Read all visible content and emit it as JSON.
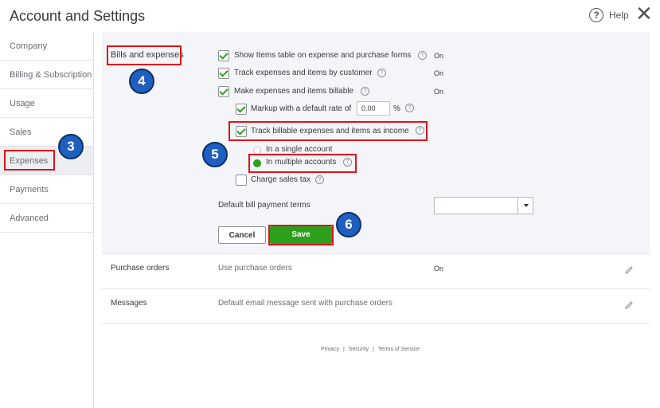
{
  "header": {
    "title": "Account and Settings",
    "help_label": "Help"
  },
  "sidebar": {
    "items": [
      {
        "label": "Company"
      },
      {
        "label": "Billing & Subscription"
      },
      {
        "label": "Usage"
      },
      {
        "label": "Sales"
      },
      {
        "label": "Expenses"
      },
      {
        "label": "Payments"
      },
      {
        "label": "Advanced"
      }
    ]
  },
  "bills": {
    "section_label": "Bills and expenses",
    "show_items": {
      "label": "Show Items table on expense and purchase forms",
      "status": "On",
      "checked": true
    },
    "track_by_customer": {
      "label": "Track expenses and items by customer",
      "status": "On",
      "checked": true
    },
    "billable": {
      "label": "Make expenses and items billable",
      "status": "On",
      "checked": true
    },
    "markup": {
      "label": "Markup with a default rate of",
      "value": "0.00",
      "unit": "%",
      "checked": true
    },
    "track_income": {
      "label": "Track billable expenses and items as income",
      "checked": true
    },
    "single_account": {
      "label": "In a single account",
      "selected": false
    },
    "multiple_accounts": {
      "label": "In multiple accounts",
      "selected": true
    },
    "charge_tax": {
      "label": "Charge sales tax",
      "checked": false
    },
    "payment_terms": {
      "label": "Default bill payment terms",
      "value": ""
    },
    "cancel_label": "Cancel",
    "save_label": "Save"
  },
  "purchase_orders": {
    "section_label": "Purchase orders",
    "setting": "Use purchase orders",
    "status": "On"
  },
  "messages": {
    "section_label": "Messages",
    "setting": "Default email message sent with purchase orders"
  },
  "footer": {
    "privacy": "Privacy",
    "security": "Security",
    "terms": "Terms of Service"
  },
  "badges": {
    "b3": "3",
    "b4": "4",
    "b5": "5",
    "b6": "6"
  },
  "colors": {
    "accent_green": "#2ca01c",
    "annotation_red": "#e0131a",
    "badge_blue": "#1f5fbf"
  }
}
